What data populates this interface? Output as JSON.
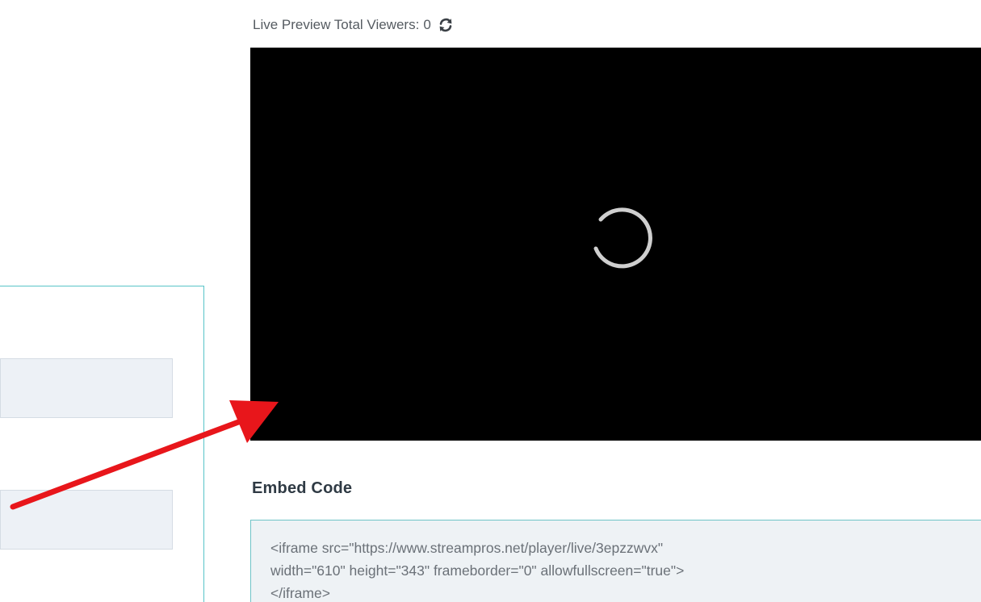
{
  "viewers": {
    "label": "Live Preview Total Viewers:",
    "count": "0",
    "refresh_icon": "refresh-icon"
  },
  "player": {
    "state_icon": "loading-spinner-icon"
  },
  "embed": {
    "title": "Embed Code",
    "code": "<iframe src=\"https://www.streampros.net/player/live/3epzzwvx\"\nwidth=\"610\" height=\"343\" frameborder=\"0\" allowfullscreen=\"true\">\n</iframe>"
  },
  "annotation": {
    "arrow_icon": "red-arrow-icon",
    "arrow_color": "#e8161b"
  },
  "colors": {
    "accent_border": "#58c4c8",
    "field_bg": "#edf1f6",
    "embed_bg": "#eef2f5"
  }
}
